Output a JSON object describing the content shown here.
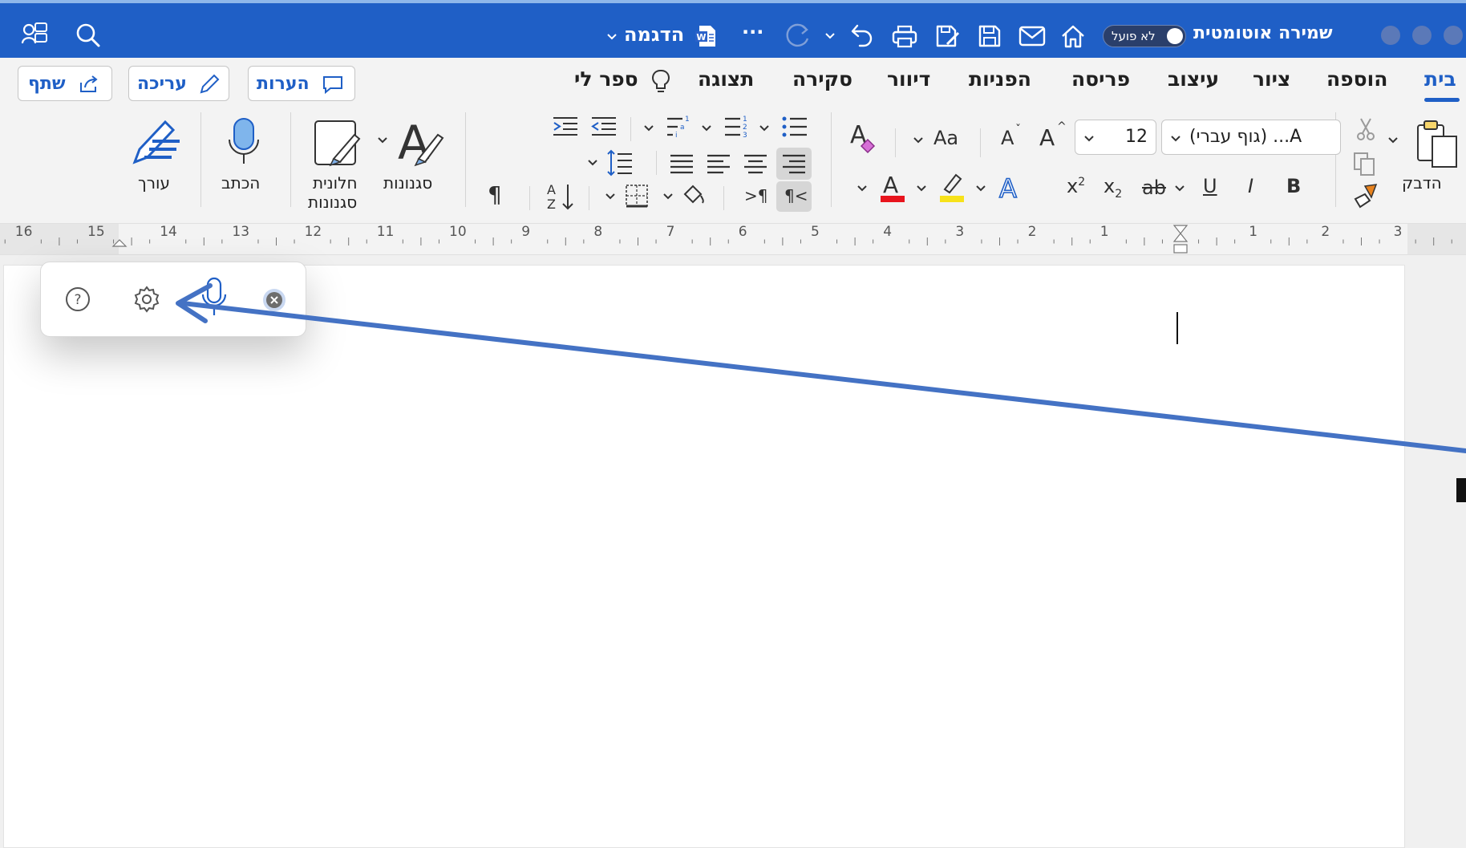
{
  "titlebar": {
    "autosave_label": "שמירה אוטומטית",
    "autosave_state": "לא פועל",
    "doc_title": "הדגמה",
    "more": "···"
  },
  "ribbon": {
    "tabs": [
      "בית",
      "הוספה",
      "ציור",
      "עיצוב",
      "פריסה",
      "הפניות",
      "דיוור",
      "סקירה",
      "תצוגה"
    ],
    "tell_me": "ספר לי",
    "share": "שתף",
    "edit": "עריכה",
    "comments": "הערות",
    "paste": "הדבק",
    "font_name": "(גוף עברי) ...A",
    "font_size": "12",
    "styles": "סגנונות",
    "styles_pane_line1": "חלונית",
    "styles_pane_line2": "סגנונות",
    "dictate": "הכתב",
    "editor": "עורך",
    "bold": "B",
    "italic": "I",
    "underline": "U",
    "strike": "ab",
    "subscript": "x",
    "superscript": "x",
    "change_case": "Aa",
    "grow_font": "A",
    "shrink_font": "A",
    "pilcrow": "¶",
    "sort": "A↓Z"
  },
  "ruler": {
    "left_numbers": [
      "16",
      "15",
      "14",
      "13",
      "12",
      "11",
      "10",
      "9",
      "8",
      "7",
      "6",
      "5",
      "4",
      "3",
      "2",
      "1"
    ],
    "right_numbers": [
      "1",
      "2",
      "3"
    ]
  },
  "colors": {
    "accent": "#1f5fc6",
    "font_color": "#e8141d",
    "highlight": "#f7e21a",
    "annotation_arrow": "#4472c4"
  }
}
